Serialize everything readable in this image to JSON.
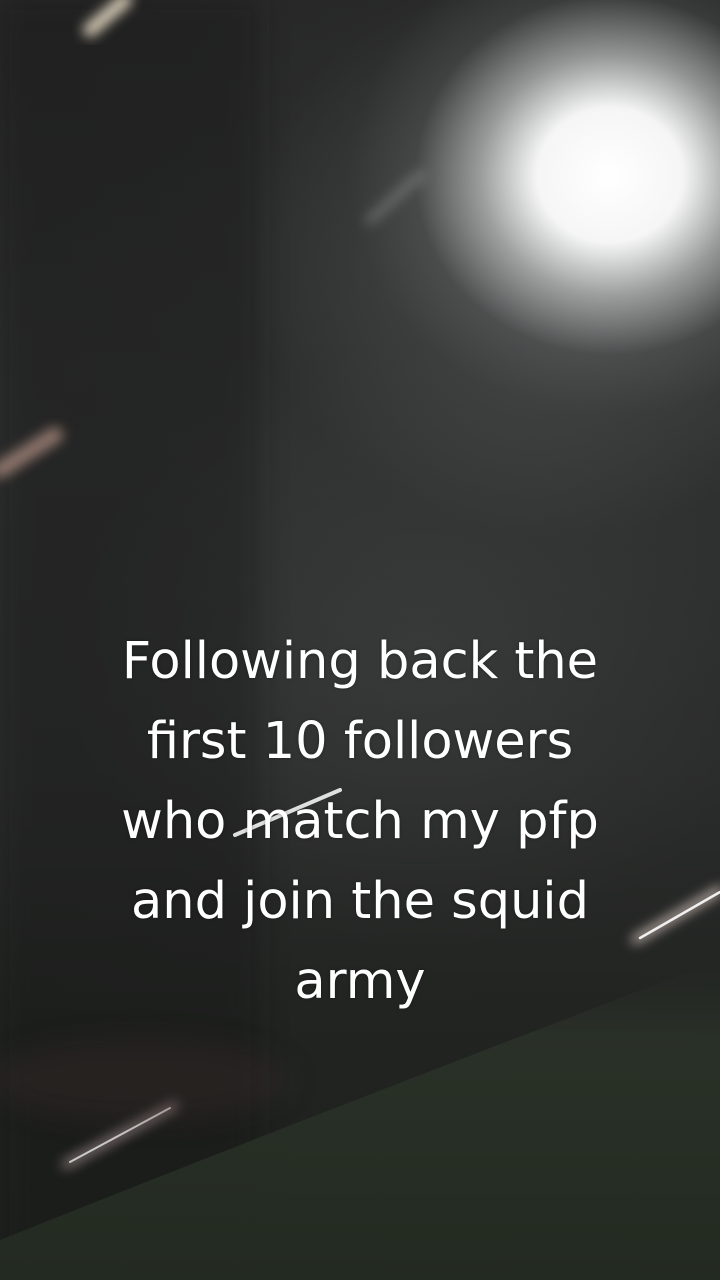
{
  "caption": {
    "lines": [
      "Following back the",
      "first 10 followers",
      "who match my pfp",
      "and join the squid",
      "army"
    ]
  }
}
